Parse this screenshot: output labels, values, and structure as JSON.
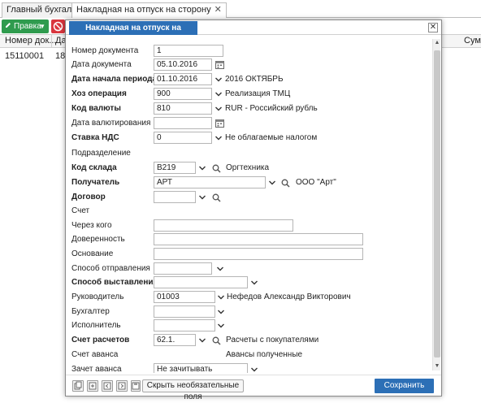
{
  "tabs": [
    {
      "label": "Главный бухгалтер"
    },
    {
      "label": "Накладная на отпуск на сторону",
      "close": "✕"
    }
  ],
  "toolbar": {
    "edit_label": "Правка"
  },
  "grid": {
    "headers": [
      "Номер док...",
      "Да",
      "Сум"
    ],
    "row": [
      "15110001",
      "18"
    ]
  },
  "modal": {
    "title": "Накладная на отпуск на сторону",
    "close": "✕",
    "hide_optional_label": "Скрыть необязательные поля",
    "save_label": "Сохранить"
  },
  "form": {
    "doc_number": {
      "label": "Номер документа",
      "value": "1"
    },
    "doc_date": {
      "label": "Дата документа",
      "value": "05.10.2016"
    },
    "period_start": {
      "label": "Дата начала периода",
      "value": "01.10.2016",
      "note": "2016 ОКТЯБРЬ"
    },
    "operation": {
      "label": "Хоз операция",
      "value": "900",
      "note": "Реализация ТМЦ"
    },
    "currency": {
      "label": "Код валюты",
      "value": "810",
      "note": "RUR - Российский рубль"
    },
    "currency_date": {
      "label": "Дата валютирования",
      "value": ""
    },
    "vat": {
      "label": "Ставка НДС",
      "value": "0",
      "note": "Не облагаемые налогом"
    },
    "department": {
      "label": "Подразделение"
    },
    "warehouse": {
      "label": "Код склада",
      "value": "B219",
      "note": "Оргтехника"
    },
    "recipient": {
      "label": "Получатель",
      "value": "АРТ",
      "note": "ООО \"Арт\""
    },
    "contract": {
      "label": "Договор",
      "value": ""
    },
    "account": {
      "label": "Счет"
    },
    "through": {
      "label": "Через кого",
      "value": ""
    },
    "power_of_attorney": {
      "label": "Доверенность",
      "value": ""
    },
    "basis": {
      "label": "Основание",
      "value": ""
    },
    "shipping_method": {
      "label": "Способ отправления",
      "value": ""
    },
    "billing_method": {
      "label": "Способ выставления",
      "value": ""
    },
    "manager": {
      "label": "Руководитель",
      "value": "01003",
      "note": "Нефедов Александр Викторович"
    },
    "accountant": {
      "label": "Бухгалтер",
      "value": ""
    },
    "executor": {
      "label": "Исполнитель",
      "value": ""
    },
    "settlement_account": {
      "label": "Счет расчетов",
      "value": "62.1.",
      "note": "Расчеты с покупателями"
    },
    "advance_account": {
      "label": "Счет аванса",
      "note": "Авансы полученные"
    },
    "advance_offset": {
      "label": "Зачет аванса",
      "value": "Не зачитывать"
    }
  },
  "colors": {
    "accent": "#2c6fb6",
    "edit_button": "#2f9b4e",
    "delete_button": "#d9363e"
  }
}
